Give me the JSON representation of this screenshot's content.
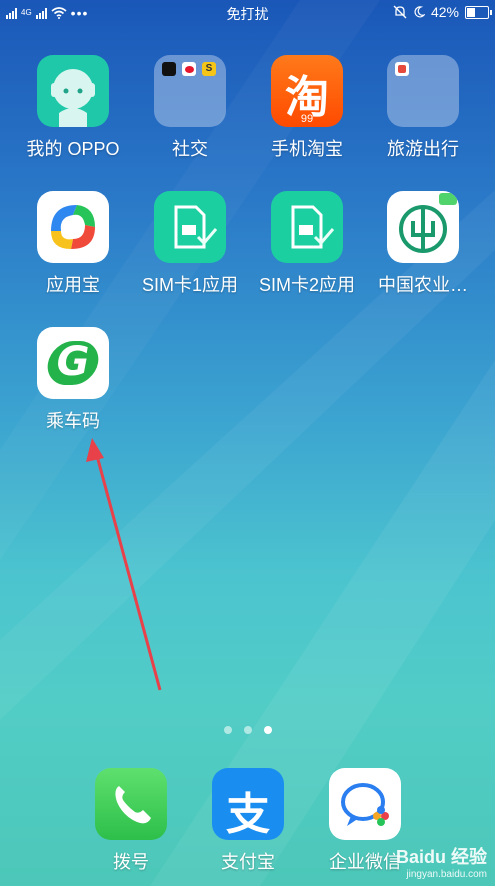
{
  "status_bar": {
    "network_label": "4G",
    "dnd_label": "免打扰",
    "battery_percent": "42%",
    "battery_level": 0.42
  },
  "apps": [
    {
      "label": "我的 OPPO",
      "icon": "oppo-face-icon"
    },
    {
      "label": "社交",
      "icon": "social-folder-icon"
    },
    {
      "label": "手机淘宝",
      "icon": "taobao-icon",
      "glyph": "淘",
      "badge": "99"
    },
    {
      "label": "旅游出行",
      "icon": "travel-folder-icon"
    },
    {
      "label": "应用宝",
      "icon": "yingyongbao-icon"
    },
    {
      "label": "SIM卡1应用",
      "icon": "sim-card-icon"
    },
    {
      "label": "SIM卡2应用",
      "icon": "sim-card-icon"
    },
    {
      "label": "中国农业…",
      "icon": "abc-bank-icon"
    },
    {
      "label": "乘车码",
      "icon": "ride-code-icon",
      "glyph": "G"
    }
  ],
  "page_indicator": {
    "count": 3,
    "active_index": 2
  },
  "dock": [
    {
      "label": "拨号",
      "icon": "phone-icon"
    },
    {
      "label": "支付宝",
      "icon": "alipay-icon",
      "glyph": "支"
    },
    {
      "label": "企业微信",
      "icon": "wecom-icon"
    }
  ],
  "watermark": {
    "main": "Baidu 经验",
    "sub": "jingyan.baidu.com"
  },
  "colors": {
    "oppo": "#1fc8a8",
    "taobao": "#ff5a00",
    "sim": "#1ccfa0",
    "ride": "#24b34a",
    "phone": "#3ad15a",
    "alipay": "#1a8ef0",
    "annotation_arrow": "#e8414a"
  }
}
